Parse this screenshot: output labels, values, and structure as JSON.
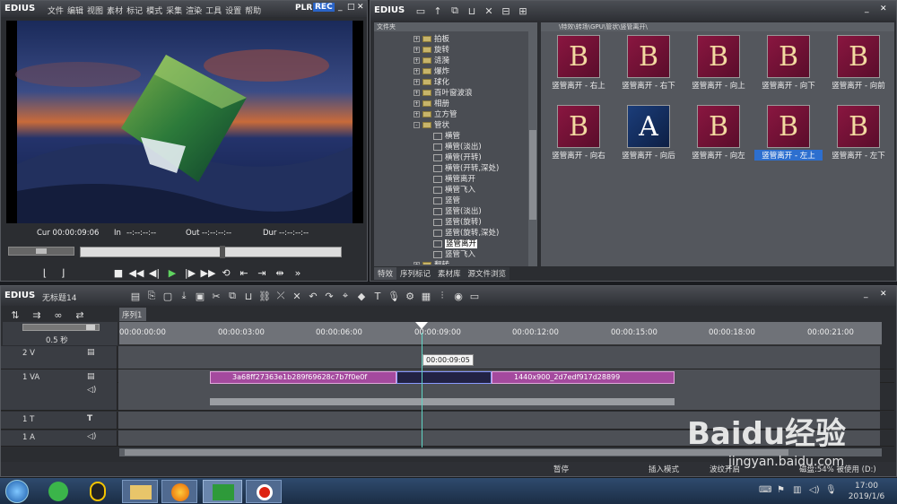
{
  "app": {
    "name": "EDIUS"
  },
  "menu": [
    "文件",
    "编辑",
    "视图",
    "素材",
    "标记",
    "模式",
    "采集",
    "渲染",
    "工具",
    "设置",
    "帮助"
  ],
  "preview": {
    "plr": "PLR",
    "rec": "REC",
    "cur_label": "Cur",
    "cur_value": "00:00:09:06",
    "in_label": "In",
    "in_value": "--:--:--:--",
    "out_label": "Out",
    "out_value": "--:--:--:--",
    "dur_label": "Dur",
    "dur_value": "--:--:--:--"
  },
  "bin": {
    "title": "EDIUS",
    "folder_header": "文件夹",
    "path": "\\特效\\转场\\GPU\\管状\\竖管离开\\",
    "tree": [
      "拍板",
      "旋转",
      "涟漪",
      "爆炸",
      "球化",
      "百叶窗波浪",
      "相册",
      "立方管",
      "管状",
      "横管",
      "横管(淡出)",
      "横管(开转)",
      "横管(开转,深处)",
      "横管离开",
      "横管飞入",
      "竖管",
      "竖管(淡出)",
      "竖管(旋转)",
      "竖管(旋转,深处)",
      "竖管离开",
      "竖管飞入",
      "翻转"
    ],
    "thumbs": [
      "竖管离开 - 右上",
      "竖管离开 - 右下",
      "竖管离开 - 向上",
      "竖管离开 - 向下",
      "竖管离开 - 向前",
      "竖管离开 - 向右",
      "竖管离开 - 向后",
      "竖管离开 - 向左",
      "竖管离开 - 左上",
      "竖管离开 - 左下"
    ],
    "tabs": [
      "特效",
      "序列标记",
      "素材库",
      "源文件浏览"
    ]
  },
  "timeline": {
    "project_title": "无标题14",
    "sequence_tab": "序列1",
    "zoom": "0.5 秒",
    "ticks": [
      "00:00:00:00",
      "00:00:03:00",
      "00:00:06:00",
      "00:00:09:00",
      "00:00:12:00",
      "00:00:15:00",
      "00:00:18:00",
      "00:00:21:00"
    ],
    "cursor_tip": "00:00:09:05",
    "tracks": [
      {
        "name": "2 V"
      },
      {
        "name": "1 VA"
      },
      {
        "name": "1 T"
      },
      {
        "name": "1 A"
      }
    ],
    "clip1": "3a68ff27363e1b289f69628c7b7f0e0f",
    "clip2": "1440x900_2d7edf917d28899"
  },
  "status": {
    "pause": "暂停",
    "insert": "插入模式",
    "ripple": "波纹开启",
    "disk": "磁盘:54% 被使用 (D:)"
  },
  "taskbar": {
    "time": "17:00",
    "date": "2019/1/6"
  },
  "watermark": {
    "text": "Baidu经验",
    "url": "jingyan.baidu.com"
  },
  "colors": {
    "accent": "#2d6fcf",
    "clip": "#a44a9e",
    "rec": "#2a64c8"
  }
}
